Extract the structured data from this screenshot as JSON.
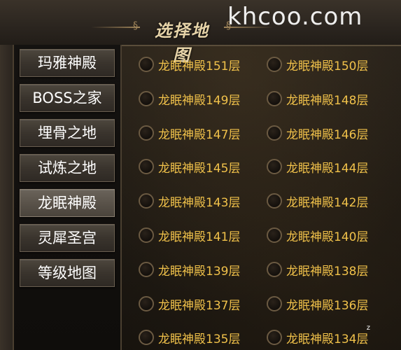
{
  "header": {
    "title": "选择地图",
    "watermark": "khcoo.com",
    "ornament_left": "§",
    "ornament_right": "§"
  },
  "sidebar": {
    "items": [
      {
        "label": "玛雅神殿",
        "active": false
      },
      {
        "label": "BOSS之家",
        "active": false
      },
      {
        "label": "埋骨之地",
        "active": false
      },
      {
        "label": "试炼之地",
        "active": false
      },
      {
        "label": "龙眠神殿",
        "active": true
      },
      {
        "label": "灵犀圣宫",
        "active": false
      },
      {
        "label": "等级地图",
        "active": false
      }
    ]
  },
  "map_list": {
    "items": [
      "龙眠神殿151层",
      "龙眠神殿150层",
      "龙眠神殿149层",
      "龙眠神殿148层",
      "龙眠神殿147层",
      "龙眠神殿146层",
      "龙眠神殿145层",
      "龙眠神殿144层",
      "龙眠神殿143层",
      "龙眠神殿142层",
      "龙眠神殿141层",
      "龙眠神殿140层",
      "龙眠神殿139层",
      "龙眠神殿138层",
      "龙眠神殿137层",
      "龙眠神殿136层",
      "龙眠神殿135层",
      "龙眠神殿134层"
    ]
  },
  "corner_mark": "z",
  "colors": {
    "item_text": "#f0c14a",
    "title_text": "#e6d3a8"
  }
}
